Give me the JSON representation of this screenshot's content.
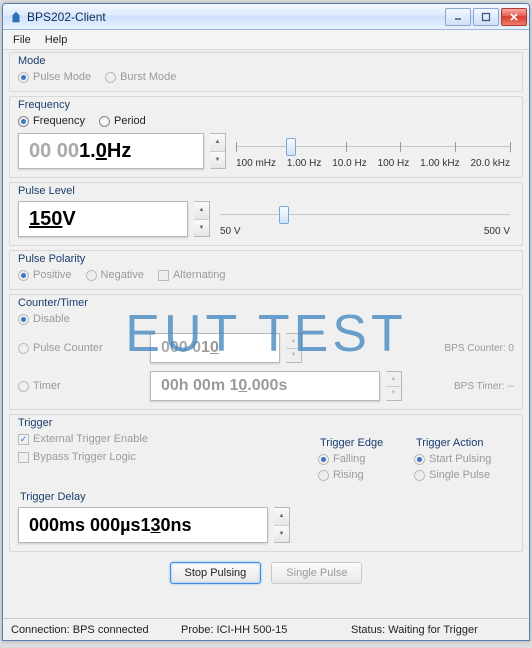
{
  "window": {
    "title": "BPS202-Client"
  },
  "menu": {
    "file": "File",
    "help": "Help"
  },
  "mode": {
    "legend": "Mode",
    "pulse": "Pulse Mode",
    "burst": "Burst Mode"
  },
  "frequency": {
    "legend": "Frequency",
    "freq": "Frequency",
    "period": "Period",
    "value_faded": "00 00",
    "value_main": "1.",
    "value_ul": "0",
    "value_unit": " Hz",
    "scale": [
      "100 mHz",
      "1.00 Hz",
      "10.0 Hz",
      "100 Hz",
      "1.00 kHz",
      "20.0 kHz"
    ]
  },
  "pulseLevel": {
    "legend": "Pulse Level",
    "value_main": "150",
    "value_unit": " V",
    "scale_left": "50 V",
    "scale_right": "500 V"
  },
  "polarity": {
    "legend": "Pulse Polarity",
    "positive": "Positive",
    "negative": "Negative",
    "alternating": "Alternating"
  },
  "counter": {
    "legend": "Counter/Timer",
    "disable": "Disable",
    "pulseCounter": "Pulse Counter",
    "pc_faded": "000 0",
    "pc_main": "1",
    "pc_ul": "0",
    "pc_status": "BPS Counter: 0",
    "timer": "Timer",
    "t_val_a": "00h 00m 1",
    "t_val_ul": "0",
    "t_val_b": ".000s",
    "t_status": "BPS Timer: --"
  },
  "trigger": {
    "legend": "Trigger",
    "extEnable": "External Trigger Enable",
    "bypass": "Bypass Trigger Logic",
    "edgeLegend": "Trigger Edge",
    "falling": "Falling",
    "rising": "Rising",
    "actionLegend": "Trigger Action",
    "start": "Start Pulsing",
    "single": "Single Pulse",
    "delayLegend": "Trigger Delay",
    "delay_a": "000ms 000µs ",
    "delay_main": "1",
    "delay_ul": "3",
    "delay_b": "0ns"
  },
  "buttons": {
    "stop": "Stop Pulsing",
    "single": "Single Pulse"
  },
  "status": {
    "conn": "Connection: BPS connected",
    "probe": "Probe: ICI-HH 500-15",
    "stat": "Status: Waiting for Trigger"
  },
  "watermark": "EUT TEST"
}
